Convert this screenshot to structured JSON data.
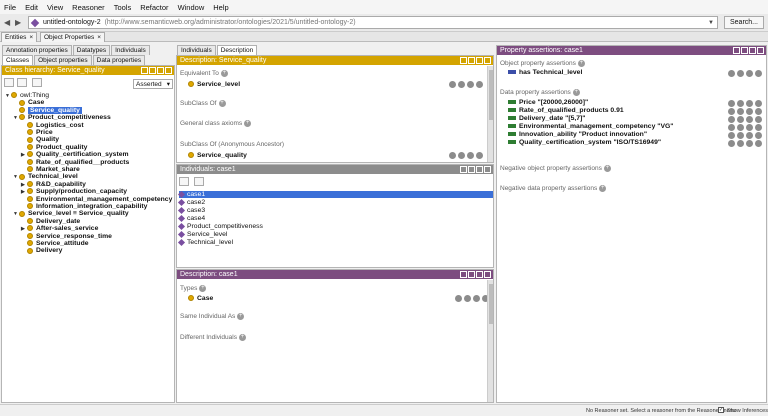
{
  "menu": [
    "File",
    "Edit",
    "View",
    "Reasoner",
    "Tools",
    "Refactor",
    "Window",
    "Help"
  ],
  "ontology": {
    "name": "untitled-ontology-2",
    "iri": "(http://www.semanticweb.org/administrator/ontologies/2021/5/untitled-ontology-2)",
    "search_label": "Search..."
  },
  "workspace_tabs": [
    "Entities",
    "Object Properties"
  ],
  "left": {
    "tabs_row1": [
      "Annotation properties",
      "Datatypes",
      "Individuals"
    ],
    "tabs_row2": [
      "Classes",
      "Object properties",
      "Data properties"
    ],
    "header": "Class hierarchy: Service_quality",
    "asserted": "Asserted",
    "tree": [
      {
        "label": "owl:Thing",
        "indent": 0,
        "toggle": "▼",
        "bold": false
      },
      {
        "label": "Case",
        "indent": 1,
        "toggle": "",
        "bold": true
      },
      {
        "label": "Service_quality",
        "indent": 1,
        "toggle": "",
        "bold": true,
        "selected": true
      },
      {
        "label": "Product_competitiveness",
        "indent": 1,
        "toggle": "▼",
        "bold": true
      },
      {
        "label": "Logistics_cost",
        "indent": 2,
        "toggle": "",
        "bold": true
      },
      {
        "label": "Price",
        "indent": 2,
        "toggle": "",
        "bold": true
      },
      {
        "label": "Quality",
        "indent": 2,
        "toggle": "",
        "bold": true
      },
      {
        "label": "Product_quality",
        "indent": 2,
        "toggle": "",
        "bold": true
      },
      {
        "label": "Quality_certification_system",
        "indent": 2,
        "toggle": "▶",
        "bold": true
      },
      {
        "label": "Rate_of_qualified__products",
        "indent": 2,
        "toggle": "",
        "bold": true
      },
      {
        "label": "Market_share",
        "indent": 2,
        "toggle": "",
        "bold": true
      },
      {
        "label": "Technical_level",
        "indent": 1,
        "toggle": "▼",
        "bold": true
      },
      {
        "label": "R&D_capability",
        "indent": 2,
        "toggle": "▶",
        "bold": true
      },
      {
        "label": "Supply/production_capacity",
        "indent": 2,
        "toggle": "▶",
        "bold": true
      },
      {
        "label": "Environmental_management_competency",
        "indent": 2,
        "toggle": "",
        "bold": true
      },
      {
        "label": "Information_integration_capability",
        "indent": 2,
        "toggle": "",
        "bold": true
      },
      {
        "label": "Service_level ≡ Service_quality",
        "indent": 1,
        "toggle": "▼",
        "bold": true
      },
      {
        "label": "Delivery_date",
        "indent": 2,
        "toggle": "",
        "bold": true
      },
      {
        "label": "After-sales_service",
        "indent": 2,
        "toggle": "▶",
        "bold": true
      },
      {
        "label": "Service_response_time",
        "indent": 2,
        "toggle": "",
        "bold": true
      },
      {
        "label": "Service_attitude",
        "indent": 2,
        "toggle": "",
        "bold": true
      },
      {
        "label": "Delivery",
        "indent": 2,
        "toggle": "",
        "bold": true
      }
    ]
  },
  "middle": {
    "tabs": [
      "Individuals",
      "Description"
    ],
    "desc_header": "Description: Service_quality",
    "equivalent_to": "Equivalent To",
    "equivalent_value": "Service_level",
    "subclass_of": "SubClass Of",
    "general_axioms": "General class axioms",
    "subclass_anon": "SubClass Of (Anonymous Ancestor)",
    "subclass_anon_value": "Service_quality",
    "ind_header": "Individuals: case1",
    "individuals": [
      "case1",
      "case2",
      "case3",
      "case4",
      "Product_competitiveness",
      "Service_level",
      "Technical_level"
    ],
    "desc2_header": "Description: case1",
    "types": "Types",
    "type_value": "Case",
    "same_individual": "Same Individual As",
    "different_individuals": "Different Individuals"
  },
  "right": {
    "header": "Property assertions: case1",
    "obj_label": "Object property assertions",
    "obj_items": [
      "has  Technical_level"
    ],
    "data_label": "Data property assertions",
    "data_items": [
      "Price  \"[20000,26000]\"",
      "Rate_of_qualified_products  0.91",
      "Delivery_date  \"[5,7]\"",
      "Environmental_management_competency  \"VG\"",
      "Innovation_ability  \"Product innovation\"",
      "Quality_certification_system  \"ISO/TS16949\""
    ],
    "neg_obj": "Negative object property assertions",
    "neg_data": "Negative data property assertions"
  },
  "status": {
    "message": "No Reasoner set. Select a reasoner from the Reasoner menu",
    "show_inferences": "Show Inferences"
  },
  "colors": {
    "class_header": "#d4a400",
    "individual_header": "#7d4d80",
    "selection": "#3a6fd8"
  }
}
